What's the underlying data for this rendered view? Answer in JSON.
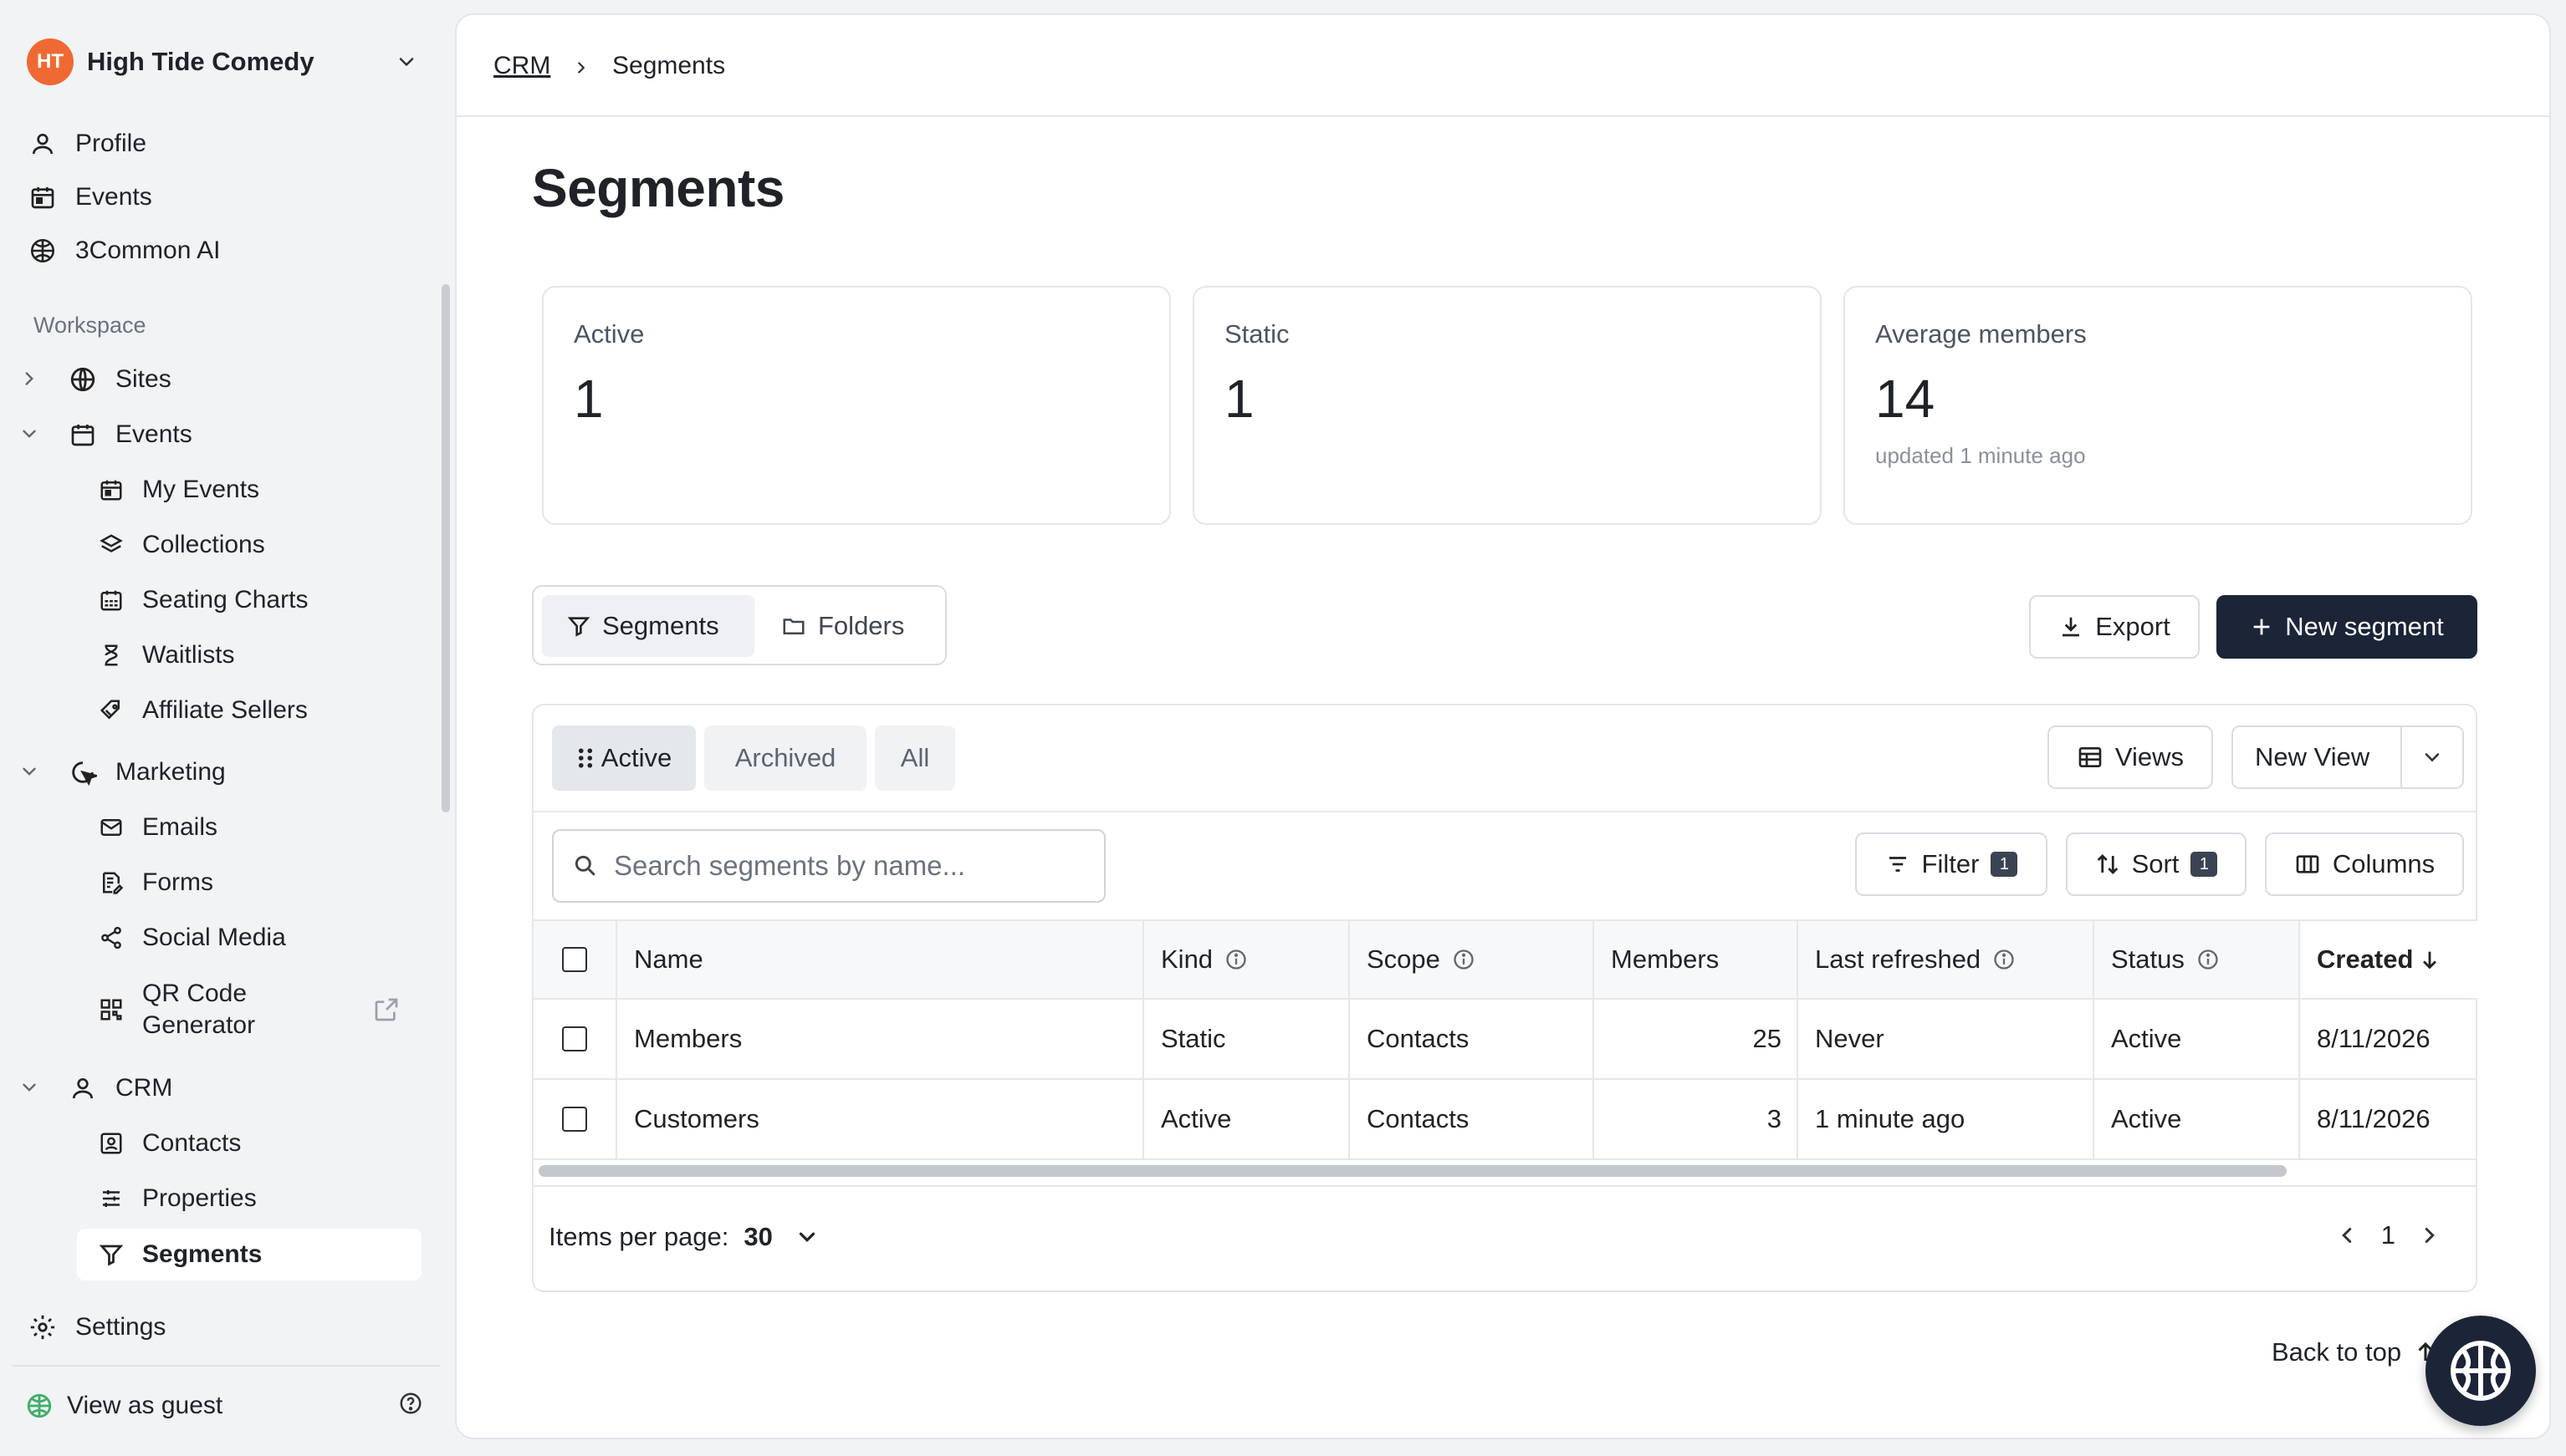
{
  "org": {
    "name": "High Tide Comedy",
    "logo_text": "HT"
  },
  "top_nav": [
    {
      "label": "Profile",
      "icon": "user-icon"
    },
    {
      "label": "Events",
      "icon": "calendar-icon"
    },
    {
      "label": "3Common AI",
      "icon": "brain-icon"
    }
  ],
  "workspace_label": "Workspace",
  "workspace": {
    "sites": "Sites",
    "events": "Events",
    "events_items": [
      "My Events",
      "Collections",
      "Seating Charts",
      "Waitlists",
      "Affiliate Sellers"
    ],
    "marketing": "Marketing",
    "marketing_items": [
      "Emails",
      "Forms",
      "Social Media"
    ],
    "qr_line1": "QR Code",
    "qr_line2": "Generator",
    "crm": "CRM",
    "crm_items": [
      "Contacts",
      "Properties",
      "Segments"
    ]
  },
  "settings": "Settings",
  "view_as_guest": "View as guest",
  "breadcrumb": {
    "parent": "CRM",
    "current": "Segments"
  },
  "page_title": "Segments",
  "stats": [
    {
      "label": "Active",
      "value": "1",
      "note": ""
    },
    {
      "label": "Static",
      "value": "1",
      "note": ""
    },
    {
      "label": "Average members",
      "value": "14",
      "note": "updated 1 minute ago"
    }
  ],
  "view_toggle": {
    "segments": "Segments",
    "folders": "Folders",
    "selected": "Segments"
  },
  "actions": {
    "export": "Export",
    "new_segment": "New segment"
  },
  "filter_tabs": [
    "Active",
    "Archived",
    "All"
  ],
  "filter_tab_selected": "Active",
  "views_button": "Views",
  "new_view_button": "New View",
  "search": {
    "placeholder": "Search segments by name..."
  },
  "toolbar": {
    "filter": "Filter",
    "filter_count": "1",
    "sort": "Sort",
    "sort_count": "1",
    "columns": "Columns"
  },
  "table": {
    "columns": [
      "Name",
      "Kind",
      "Scope",
      "Members",
      "Last refreshed",
      "Status",
      "Created"
    ],
    "rows": [
      {
        "name": "Members",
        "kind": "Static",
        "scope": "Contacts",
        "members": "25",
        "last_refreshed": "Never",
        "status": "Active",
        "created": "8/11/2026"
      },
      {
        "name": "Customers",
        "kind": "Active",
        "scope": "Contacts",
        "members": "3",
        "last_refreshed": "1 minute ago",
        "status": "Active",
        "created": "8/11/2026"
      }
    ]
  },
  "pagination": {
    "items_per_page_label": "Items per page:",
    "items_per_page": "30",
    "page": "1"
  },
  "back_to_top": "Back to top",
  "colors": {
    "primary": "#1c2438",
    "brand": "#ef6a32",
    "guest_icon": "#3fae6a"
  }
}
